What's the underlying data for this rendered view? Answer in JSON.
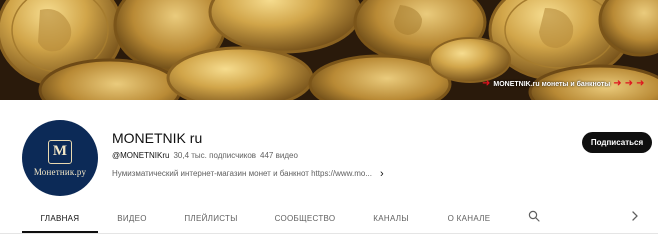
{
  "banner": {
    "strip_text": "MONETNIK.ru монеты и банкноты",
    "colors": {
      "background": "#24170c",
      "gold": "#c9a24a",
      "arrow": "#e0141e"
    }
  },
  "channel": {
    "name": "MONETNIK ru",
    "handle": "@MONETNIKru",
    "subscribers": "30,4 тыс. подписчиков",
    "videos": "447 видео",
    "description": "Нумизматический интернет-магазин монет и банкнот https://www.mo...",
    "avatar_mark": "M",
    "avatar_text": "Монетник.ру",
    "avatar_color": "#0c2a57"
  },
  "subscribe": {
    "label": "Подписаться"
  },
  "tabs": [
    {
      "label": "ГЛАВНАЯ",
      "active": true
    },
    {
      "label": "ВИДЕО"
    },
    {
      "label": "ПЛЕЙЛИСТЫ"
    },
    {
      "label": "СООБЩЕСТВО"
    },
    {
      "label": "КАНАЛЫ"
    },
    {
      "label": "О КАНАЛЕ"
    }
  ],
  "icons": {
    "search": "search-icon",
    "next": "chevron-right-icon"
  }
}
